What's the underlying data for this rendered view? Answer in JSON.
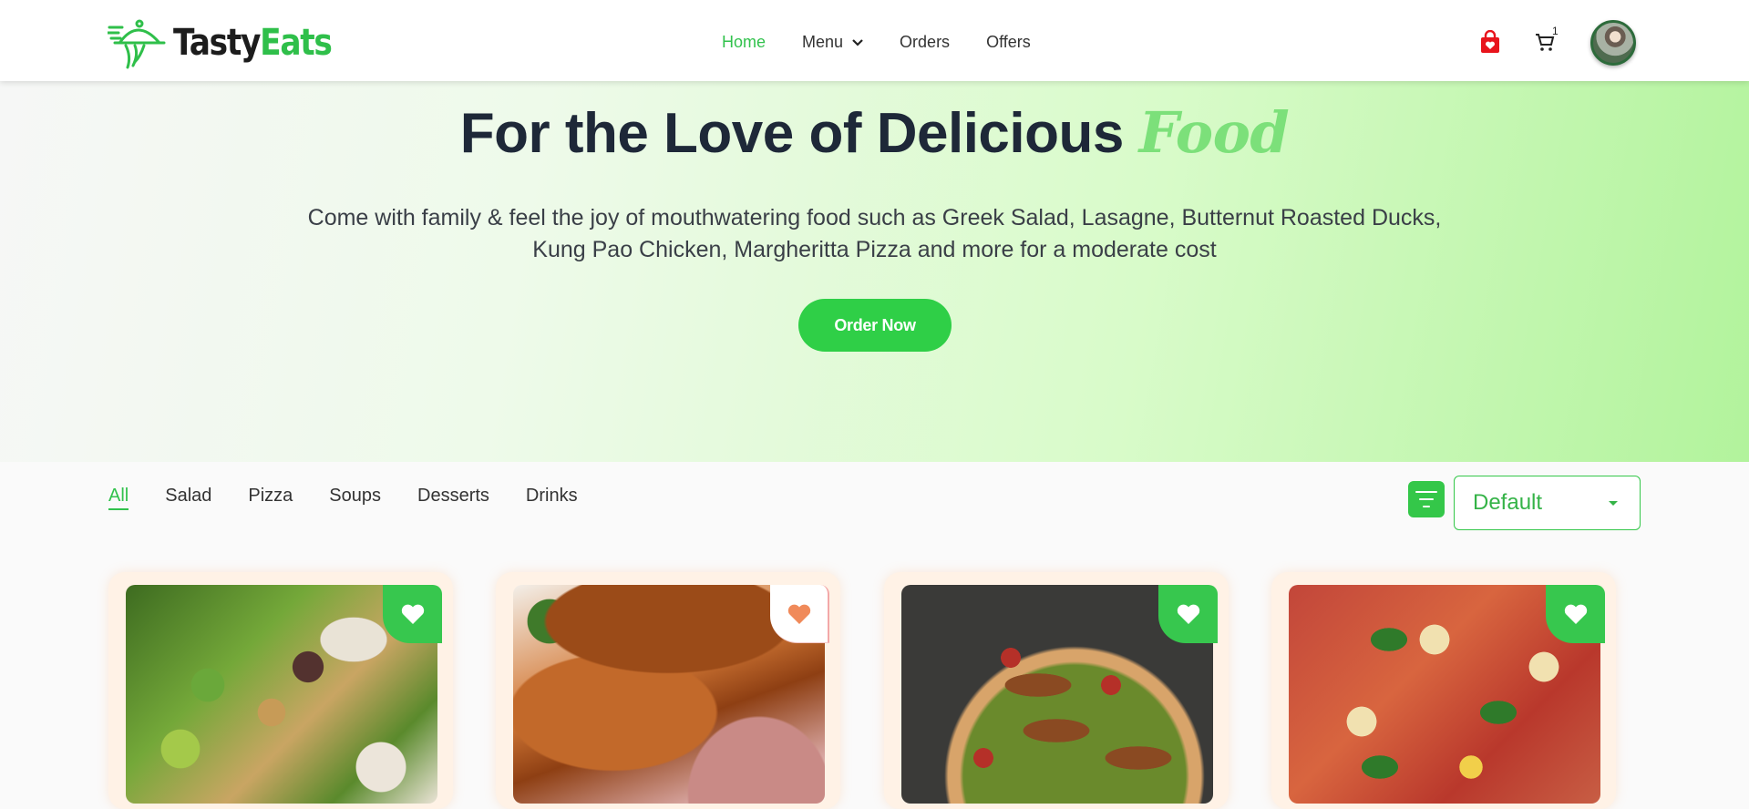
{
  "brand": {
    "name_part1": "Tasty",
    "name_part2": "Eats",
    "primary_color": "#32c24d"
  },
  "nav": {
    "items": [
      {
        "label": "Home",
        "active": true
      },
      {
        "label": "Menu",
        "active": false,
        "has_dropdown": true
      },
      {
        "label": "Orders",
        "active": false
      },
      {
        "label": "Offers",
        "active": false
      }
    ]
  },
  "header_icons": {
    "bag_icon": "shopping-bag-heart-icon",
    "cart_icon": "cart-icon",
    "cart_count": "1"
  },
  "hero": {
    "title_main": "For the Love of Delicious ",
    "title_accent": "Food",
    "subtitle": "Come with family & feel the joy of mouthwatering food such as Greek Salad, Lasagne, Butternut Roasted Ducks, Kung Pao Chicken, Margheritta Pizza and more for a moderate cost",
    "cta_label": "Order Now"
  },
  "categories": [
    {
      "label": "All",
      "active": true
    },
    {
      "label": "Salad",
      "active": false
    },
    {
      "label": "Pizza",
      "active": false
    },
    {
      "label": "Soups",
      "active": false
    },
    {
      "label": "Desserts",
      "active": false
    },
    {
      "label": "Drinks",
      "active": false
    }
  ],
  "sort": {
    "selected": "Default"
  },
  "products": [
    {
      "image": "salad",
      "favorited": false
    },
    {
      "image": "roasted-duck",
      "favorited": true
    },
    {
      "image": "sausage-pizza",
      "favorited": false
    },
    {
      "image": "cauliflower-pizza",
      "favorited": false
    }
  ]
}
